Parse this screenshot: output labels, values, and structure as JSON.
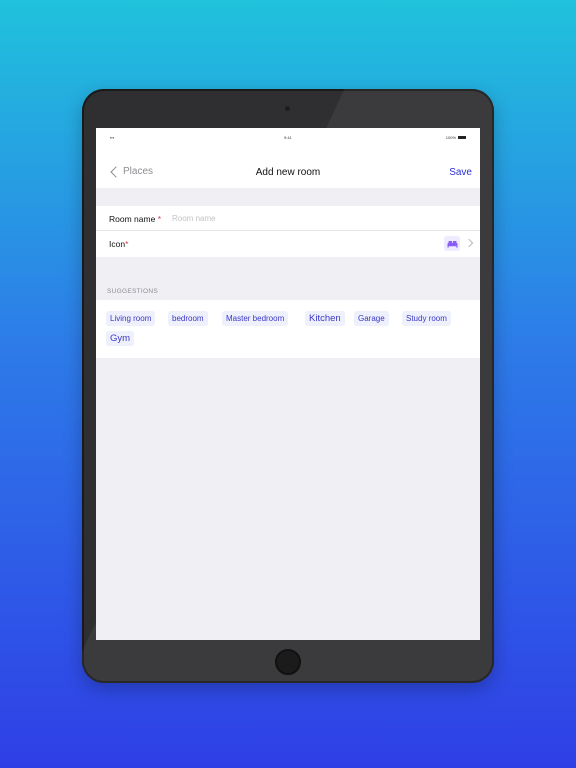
{
  "status_bar": {
    "time": "9:41",
    "battery": "100%"
  },
  "nav": {
    "back_label": "Places",
    "title": "Add new room",
    "save_label": "Save"
  },
  "form": {
    "room_name": {
      "label": "Room name",
      "required_mark": "*",
      "placeholder": "Room name",
      "value": ""
    },
    "icon": {
      "label": "Icon",
      "required_mark": "*",
      "selected_icon": "bed-icon"
    }
  },
  "suggestions": {
    "header": "SUGGESTIONS",
    "items": [
      "Living room",
      "bedroom",
      "Master bedroom",
      "Kitchen",
      "Garage",
      "Study room",
      "Gym"
    ]
  },
  "colors": {
    "accent": "#2b2fd1",
    "chip_text": "#3a37c9",
    "chip_background": "#eef0fb",
    "required": "#e0384a",
    "icon_purple": "#8a5cf6"
  }
}
